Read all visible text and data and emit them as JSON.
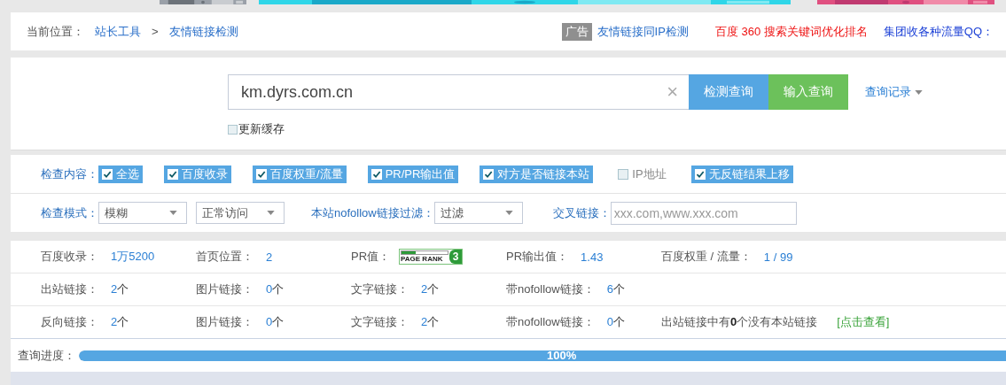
{
  "top_banners": [
    {
      "kind": "picture"
    },
    {
      "kind": "picture"
    },
    {
      "kind": "picture"
    }
  ],
  "breadcrumb": {
    "label": "当前位置：",
    "items": [
      {
        "text": "站长工具"
      },
      {
        "text": "友情链接检测"
      }
    ],
    "separator": ">"
  },
  "ads": {
    "tag": "广告",
    "links": [
      {
        "text": "友情链接同IP检测",
        "color": "#2a6fc9"
      },
      {
        "text": "百度 360 搜索关键词优化排名",
        "color": "#ee1111"
      },
      {
        "text": "集团收各种流量QQ：",
        "color": "#1a3fd6"
      }
    ]
  },
  "search": {
    "value": "km.dyrs.com.cn",
    "clear": "×",
    "buttons": [
      {
        "text": "检测查询",
        "color": "#55a6e2"
      },
      {
        "text": "输入查询",
        "color": "#6cc15b"
      }
    ],
    "history": "查询记录",
    "refresh_cache": {
      "label": "更新缓存",
      "checked": false
    }
  },
  "check_content": {
    "label": "检查内容：",
    "options": [
      {
        "label": "全选",
        "checked": true
      },
      {
        "label": "百度收录",
        "checked": true
      },
      {
        "label": "百度权重/流量",
        "checked": true
      },
      {
        "label": "PR/PR输出值",
        "checked": true
      },
      {
        "label": "对方是否链接本站",
        "checked": true
      },
      {
        "label": "IP地址",
        "checked": false
      },
      {
        "label": "无反链结果上移",
        "checked": true
      }
    ]
  },
  "check_mode": {
    "label": "检查模式：",
    "selects": [
      {
        "value": "模糊"
      },
      {
        "value": "正常访问"
      }
    ],
    "nofollow_label": "本站nofollow链接过滤：",
    "nofollow_select": {
      "value": "过滤"
    },
    "cross_label": "交叉链接：",
    "cross_field": {
      "placeholder": "xxx.com,www.xxx.com"
    }
  },
  "results": [
    [
      {
        "label": "百度收录：",
        "value": "1万5200"
      },
      {
        "label": "首页位置：",
        "value": "2"
      },
      {
        "label": "PR值：",
        "kind": "pagerank",
        "badge": "PAGE RANK",
        "rank": "3",
        "level": 0.3
      },
      {
        "label": "PR输出值：",
        "value": "1.43"
      },
      {
        "label": "百度权重 / 流量：",
        "value": "1 / 99"
      }
    ],
    [
      {
        "label": "出站链接：",
        "value": "2",
        "unit": "个"
      },
      {
        "label": "图片链接：",
        "value": "0",
        "unit": "个"
      },
      {
        "label": "文字链接：",
        "value": "2",
        "unit": "个"
      },
      {
        "label": "带nofollow链接：",
        "value": "6",
        "unit": "个"
      }
    ],
    [
      {
        "label": "反向链接：",
        "value": "2",
        "unit": "个"
      },
      {
        "label": "图片链接：",
        "value": "0",
        "unit": "个"
      },
      {
        "label": "文字链接：",
        "value": "2",
        "unit": "个"
      },
      {
        "label": "带nofollow链接：",
        "value": "0",
        "unit": "个"
      },
      {
        "kind": "note",
        "text": "出站链接中有**0**个没有本站链接",
        "link": "[点击查看]"
      }
    ]
  ],
  "progress": {
    "label": "查询进度：",
    "level": 1,
    "text": "100%"
  }
}
